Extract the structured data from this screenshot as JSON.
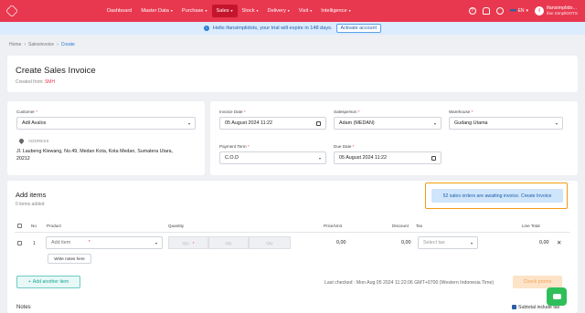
{
  "nav": {
    "items": [
      {
        "label": "Dashboard",
        "caret": false,
        "active": false
      },
      {
        "label": "Master Data",
        "caret": true,
        "active": false
      },
      {
        "label": "Purchase",
        "caret": true,
        "active": false
      },
      {
        "label": "Sales",
        "caret": true,
        "active": true
      },
      {
        "label": "Stock",
        "caret": true,
        "active": false
      },
      {
        "label": "Delivery",
        "caret": true,
        "active": false
      },
      {
        "label": "Visit",
        "caret": true,
        "active": false
      },
      {
        "label": "Intelligence",
        "caret": true,
        "active": false
      }
    ],
    "caret_glyph": "▾",
    "lang": "EN",
    "user_name": "ifansimplido...",
    "user_sub": "ifan SimpliDOTS",
    "avatar_initial": "I",
    "brand_color": "#e8384f"
  },
  "trial": {
    "message": "Hello ifansimplidots, your trial will expire in 148 days.",
    "button": "Activate account",
    "info_glyph": "i"
  },
  "breadcrumb": {
    "items": [
      "Home",
      "Salesinvoice",
      "Create"
    ],
    "separator": "›"
  },
  "header": {
    "title": "Create Sales Invoice",
    "created_from_label": "Created from:",
    "created_from_value": "SMH"
  },
  "customer": {
    "label": "Customer",
    "required": "*",
    "value": "Adil Avalos",
    "address_label": "ADDRESS",
    "address": "Jl. Laubeng Klewang, No.49, Medan Kota, Kota Medan, Sumatera Utara, 20212"
  },
  "invoice": {
    "date_label": "Invoice Date",
    "date_value": "05 August 2024 11:22",
    "salesperson_label": "Salesperson",
    "salesperson_value": "Adam (MEDAN)",
    "warehouse_label": "Warehouse",
    "warehouse_value": "Gudang Utama",
    "payment_term_label": "Payment Term",
    "payment_term_value": "C.O.D",
    "due_date_label": "Due Date",
    "due_date_value": "05 August 2024 11:22",
    "required": "*"
  },
  "items": {
    "heading": "Add items",
    "count_text": "0 items added",
    "awaiting_text": "52 sales orders are awaiting invoice. Create Invoice",
    "columns": {
      "no": "No",
      "product": "Product",
      "quantity": "Quantity",
      "price": "Price/Unit",
      "discount": "Discount",
      "tax": "Tax",
      "line_total": "Line Total"
    },
    "row": {
      "no": "1",
      "product_placeholder": "Add item",
      "required": "*",
      "qty_placeholders": [
        "Qty",
        "Qty",
        "Qty"
      ],
      "price": "0,00",
      "discount": "0,00",
      "tax_placeholder": "Select tax",
      "line_total": "0,00",
      "delete_glyph": "✕",
      "write_notes": "Write notes here"
    },
    "add_another": "Add another item",
    "add_glyph": "+",
    "last_checked": "Last checked : Mon Aug 05 2024 11:22:06 GMT+0700 (Western Indonesia Time)",
    "check_promo": "Check promo"
  },
  "footer": {
    "notes_label": "Notes",
    "subtotal_include_tax": "Subtotal include tax"
  }
}
